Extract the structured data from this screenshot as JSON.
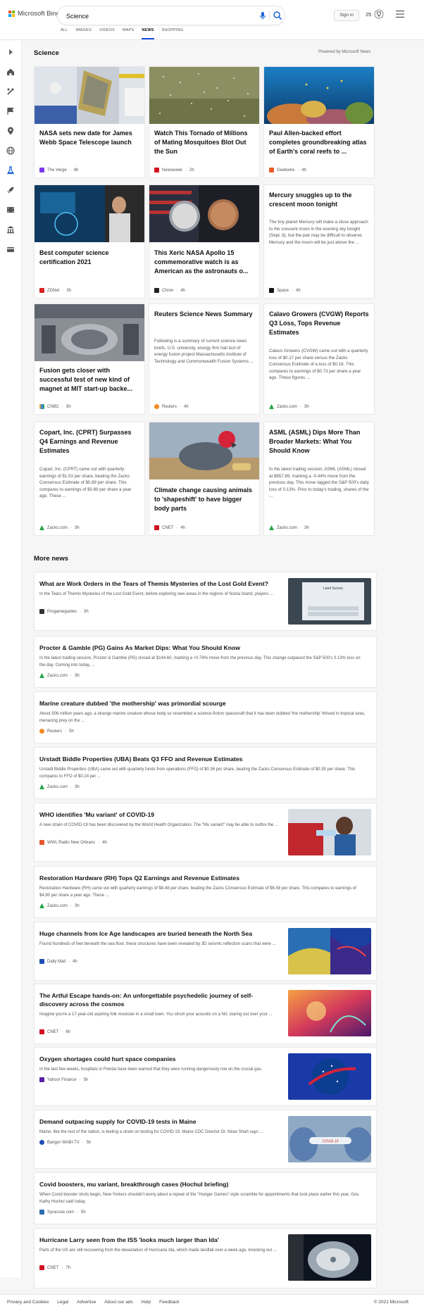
{
  "header": {
    "logo_text": "Microsoft Bing",
    "search_value": "Science",
    "signin_label": "Sign in",
    "rewards_count": "25"
  },
  "tabs": [
    {
      "label": "ALL"
    },
    {
      "label": "IMAGES"
    },
    {
      "label": "VIDEOS"
    },
    {
      "label": "MAPS"
    },
    {
      "label": "NEWS",
      "active": true
    },
    {
      "label": "SHOPPING"
    }
  ],
  "rail_icons": [
    "expand-icon",
    "home-icon",
    "tools-icon",
    "flag-icon",
    "location-icon",
    "globe-icon",
    "science-icon",
    "rocket-icon",
    "film-icon",
    "building-icon",
    "card-icon"
  ],
  "section": {
    "title": "Science",
    "powered": "Powered by Microsoft News"
  },
  "cards": [
    {
      "title": "NASA sets new date for James Webb Space Telescope launch",
      "provider": "The Verge",
      "age": "4h",
      "color": "#7c3aed"
    },
    {
      "title": "Watch This Tornado of Millions of Mating Mosquitoes Blot Out the Sun",
      "provider": "Newsweek",
      "age": "2h",
      "color": "#d1121f"
    },
    {
      "title": "Paul Allen-backed effort completes groundbreaking atlas of Earth's coral reefs to ...",
      "provider": "Geekwire",
      "age": "4h",
      "color": "#e85d2a"
    },
    {
      "title": "Best computer science certification 2021",
      "provider": "ZDNet",
      "age": "3h",
      "color": "#d92323"
    },
    {
      "title": "This Xeric NASA Apollo 15 commemorative watch is as American as the astronauts o...",
      "provider": "Chron",
      "age": "4h",
      "color": "#222222"
    },
    {
      "title": "Mercury snuggles up to the crescent moon tonight",
      "snippet": "The tiny planet Mercury will make a close approach to the crescent moon in the evening sky tonight (Sept. 8), but the pair may be difficult to observe. Mercury and the moon will be just above the ...",
      "provider": "Space",
      "age": "4h",
      "color": "#111111"
    },
    {
      "title": "Fusion gets closer with successful test of new kind of magnet at MIT start-up backe...",
      "provider": "CNBC",
      "age": "5h",
      "color": "#3b82f6"
    },
    {
      "title": "Reuters Science News Summary",
      "snippet": "Following is a summary of current science news briefs. U.S. university, energy firm hail test of energy fusion project Massachusetts Institute of Technology and Commonwealth Fusion Systems ...",
      "provider": "Reuters",
      "age": "4h",
      "color": "#f08a24"
    },
    {
      "title": "Calavo Growers (CVGW) Reports Q3 Loss, Tops Revenue Estimates",
      "snippet": "Calavo Growers (CVGW) came out with a quarterly loss of $0.17 per share versus the Zacks Consensus Estimate of a loss of $0.18. This compares to earnings of $0.73 per share a year ago. These figures ...",
      "provider": "Zacks.com",
      "age": "3h",
      "color": "#22a447"
    },
    {
      "title": "Copart, Inc. (CPRT) Surpasses Q4 Earnings and Revenue Estimates",
      "snippet": "Copart, Inc. (CPRT) came out with quarterly earnings of $1.03 per share, beating the Zacks Consensus Estimate of $0.89 per share. This compares to earnings of $0.69 per share a year ago. These ...",
      "provider": "Zacks.com",
      "age": "3h",
      "color": "#22a447"
    },
    {
      "title": "Climate change causing animals to 'shapeshift' to have bigger body parts",
      "provider": "CNET",
      "age": "4h",
      "color": "#d1121f"
    },
    {
      "title": "ASML (ASML) Dips More Than Broader Markets: What You Should Know",
      "snippet": "In the latest trading session, ASML (ASML) closed at $857.89, marking a -0.44% move from the previous day. This move lagged the S&P 500's daily loss of 0.13%. Prior to today's trading, shares of the ...",
      "provider": "Zacks.com",
      "age": "3h",
      "color": "#22a447"
    }
  ],
  "more_news": {
    "title": "More news",
    "items": [
      {
        "title": "What are Work Orders in the Tears of Themis Mysteries of the Lost Gold Event?",
        "snippet": "In the Tears of Themis Mysteries of the Lost Gold Event, before exploring new areas in the regions of Nosta Island, players ...",
        "provider": "Progameguides",
        "age": "3h",
        "color": "#333333",
        "thumb": "game",
        "thumb_text": "Land Survey"
      },
      {
        "title": "Procter & Gamble (PG) Gains As Market Dips: What You Should Know",
        "snippet": "In the latest trading session, Procter & Gamble (PG) closed at $144.60, marking a +0.76% move from the previous day. This change outpaced the S&P 500's 0.13% loss on the day. Coming into today, ...",
        "provider": "Zacks.com",
        "age": "3h",
        "color": "#22a447"
      },
      {
        "title": "Marine creature dubbed 'the mothership' was primordial scourge",
        "snippet": "About 506 million years ago, a strange marine creature whose body so resembled a science-fiction spacecraft that it has been dubbed 'the mothership' thrived in tropical seas, menacing prey on the ...",
        "provider": "Reuters",
        "age": "5h",
        "color": "#f08a24"
      },
      {
        "title": "Urstadt Biddle Properties (UBA) Beats Q3 FFO and Revenue Estimates",
        "snippet": "Urstadt Biddle Properties (UBA) came out with quarterly funds from operations (FFO) of $0.36 per share, beating the Zacks Consensus Estimate of $0.35 per share. This compares to FFO of $0.24 per ...",
        "provider": "Zacks.com",
        "age": "3h",
        "color": "#22a447"
      },
      {
        "title": "WHO identifies 'Mu variant' of COVID-19",
        "snippet": "A new strain of COVID-19 has been discovered by the World Health Organization. The \"Mu variant\" may be able to outfox the ...",
        "provider": "WWL Radio New Orleans",
        "age": "4h",
        "color": "#e4572e",
        "thumb": "covid"
      },
      {
        "title": "Restoration Hardware (RH) Tops Q2 Earnings and Revenue Estimates",
        "snippet": "Restoration Hardware (RH) came out with quarterly earnings of $8.48 per share, beating the Zacks Consensus Estimate of $6.58 per share. This compares to earnings of $4.90 per share a year ago. These ...",
        "provider": "Zacks.com",
        "age": "3h",
        "color": "#22a447"
      },
      {
        "title": "Huge channels from Ice Age landscapes are buried beneath the North Sea",
        "snippet": "Found hundreds of feet beneath the sea floor, these structures have been revealed by 3D seismic reflection scans that were ...",
        "provider": "Daily Mail",
        "age": "4h",
        "color": "#1f4fb5",
        "thumb": "seismic"
      },
      {
        "title": "The Artful Escape hands-on: An unforgettable psychedelic journey of self-discovery across the cosmos",
        "snippet": "Imagine you're a 17-year-old aspiring folk musician in a small town. You strum your acoustic on a hill, staring out over your ...",
        "provider": "CNET",
        "age": "6h",
        "color": "#d1121f",
        "thumb": "artful"
      },
      {
        "title": "Oxygen shortages could hurt space companies",
        "snippet": "In the last few weeks, hospitals in Florida have been warned that they were running dangerously low on the crucial gas.",
        "provider": "Yahoo! Finance",
        "age": "5h",
        "color": "#5b1ea8",
        "thumb": "nasa"
      },
      {
        "title": "Demand outpacing supply for COVID-19 tests in Maine",
        "snippet": "Maine, like the rest of the nation, is feeling a strain on testing for COVID-19. Maine CDC Director Dr. Nirav Shah says ...",
        "provider": "Bangor WABI-TV",
        "age": "5h",
        "color": "#1f4fb5",
        "thumb": "test",
        "thumb_text": "COVID-19"
      },
      {
        "title": "Covid boosters, mu variant, breakthrough cases (Hochul briefing)",
        "snippet": "When Covid booster shots begin, New Yorkers shouldn't worry about a repeat of the \"Hunger Games\"-style scramble for appointments that took place earlier this year, Gov. Kathy Hochul said today.",
        "provider": "Syracuse.com",
        "age": "5h",
        "color": "#2b6cb0"
      },
      {
        "title": "Hurricane Larry seen from the ISS 'looks much larger than Ida'",
        "snippet": "Parts of the US are still recovering from the devastation of Hurricane Ida, which made landfall over a week ago, knocking out ...",
        "provider": "CNET",
        "age": "7h",
        "color": "#d1121f",
        "thumb": "hurricane"
      }
    ]
  },
  "footer": {
    "links": [
      "Privacy and Cookies",
      "Legal",
      "Advertise",
      "About our ads",
      "Help",
      "Feedback"
    ],
    "copyright": "© 2021 Microsoft"
  }
}
